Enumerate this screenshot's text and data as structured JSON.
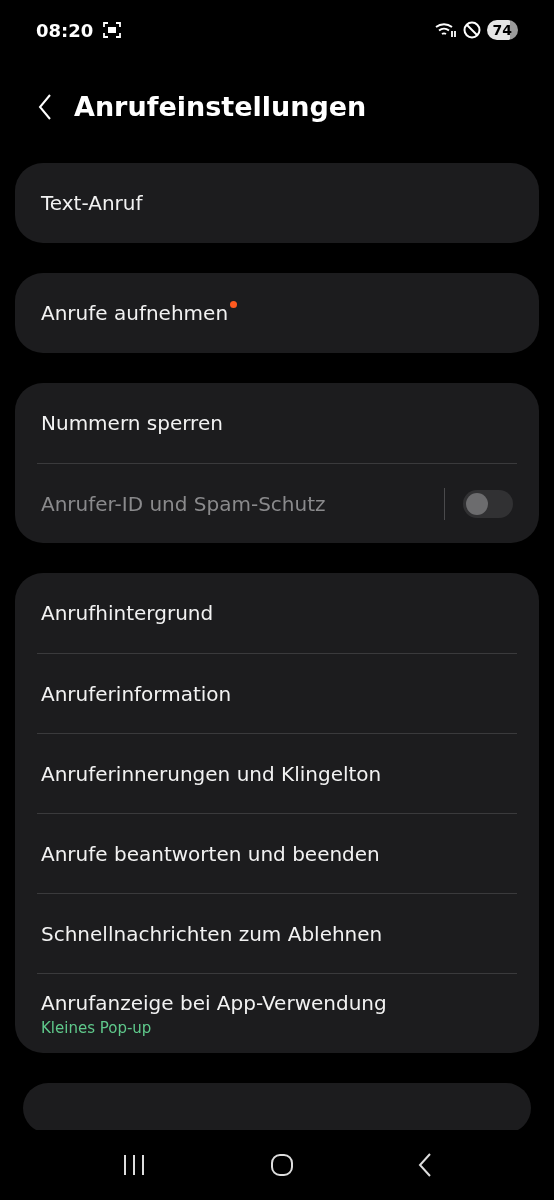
{
  "status_bar": {
    "time": "08:20",
    "battery": "74"
  },
  "header": {
    "title": "Anrufeinstellungen"
  },
  "groups": [
    {
      "items": [
        {
          "kind": "link",
          "label": "Text-Anruf",
          "new_dot": false,
          "disabled": false
        }
      ]
    },
    {
      "items": [
        {
          "kind": "link",
          "label": "Anrufe aufnehmen",
          "new_dot": true,
          "disabled": false
        }
      ]
    },
    {
      "items": [
        {
          "kind": "link",
          "label": "Nummern sperren",
          "new_dot": false,
          "disabled": false
        },
        {
          "kind": "toggle",
          "label": "Anrufer-ID und Spam-Schutz",
          "new_dot": false,
          "disabled": true,
          "on": false
        }
      ]
    },
    {
      "items": [
        {
          "kind": "link",
          "label": "Anrufhintergrund",
          "new_dot": false,
          "disabled": false
        },
        {
          "kind": "link",
          "label": "Anruferinformation",
          "new_dot": false,
          "disabled": false
        },
        {
          "kind": "link",
          "label": "Anruferinnerungen und Klingelton",
          "new_dot": false,
          "disabled": false
        },
        {
          "kind": "link",
          "label": "Anrufe beantworten und beenden",
          "new_dot": false,
          "disabled": false
        },
        {
          "kind": "link",
          "label": "Schnellnachrichten zum Ablehnen",
          "new_dot": false,
          "disabled": false
        },
        {
          "kind": "link",
          "label": "Anrufanzeige bei App-Verwendung",
          "subtitle": "Kleines Pop-up",
          "new_dot": false,
          "disabled": false
        }
      ]
    }
  ]
}
